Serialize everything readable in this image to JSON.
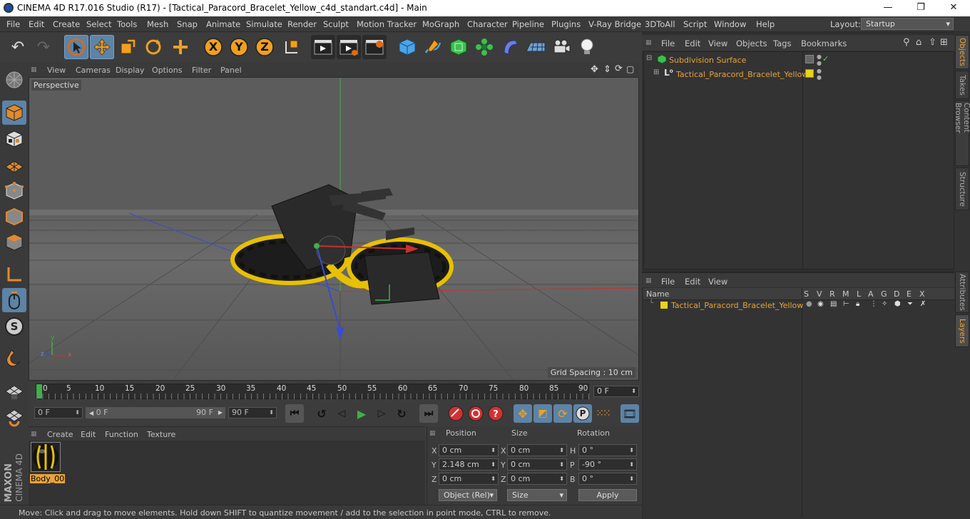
{
  "window": {
    "title": "CINEMA 4D R17.016 Studio (R17) - [Tactical_Paracord_Bracelet_Yellow_c4d_standart.c4d] - Main",
    "min": "—",
    "max": "❐",
    "close": "✕"
  },
  "menu": [
    "File",
    "Edit",
    "Create",
    "Select",
    "Tools",
    "Mesh",
    "Snap",
    "Animate",
    "Simulate",
    "Render",
    "Sculpt",
    "Motion Tracker",
    "MoGraph",
    "Character",
    "Pipeline",
    "Plugins",
    "V-Ray Bridge",
    "3DToAll",
    "Script",
    "Window",
    "Help"
  ],
  "layout": {
    "label": "Layout:",
    "value": "Startup"
  },
  "viewport": {
    "menu": [
      "View",
      "Cameras",
      "Display",
      "Options",
      "Filter",
      "Panel"
    ],
    "label": "Perspective",
    "grid_spacing": "Grid Spacing : 10 cm",
    "axis_labels": {
      "y": "y",
      "z": "z",
      "x": "x"
    }
  },
  "timeline": {
    "ticks": [
      "0",
      "5",
      "10",
      "15",
      "20",
      "25",
      "30",
      "35",
      "40",
      "45",
      "50",
      "55",
      "60",
      "65",
      "70",
      "75",
      "80",
      "85",
      "90"
    ],
    "current_frame": "0 F"
  },
  "playback": {
    "start": "0 F",
    "range_start": "0 F",
    "range_end": "90 F",
    "end": "90 F"
  },
  "material_manager": {
    "menu": [
      "Create",
      "Edit",
      "Function",
      "Texture"
    ],
    "material_name": "Body_00"
  },
  "coordinates": {
    "headers": {
      "position": "Position",
      "size": "Size",
      "rotation": "Rotation"
    },
    "rows": [
      {
        "axis": "X",
        "pos": "0 cm",
        "size_axis": "X",
        "size": "0 cm",
        "rot_axis": "H",
        "rot": "0 °"
      },
      {
        "axis": "Y",
        "pos": "2.148 cm",
        "size_axis": "Y",
        "size": "0 cm",
        "rot_axis": "P",
        "rot": "-90 °"
      },
      {
        "axis": "Z",
        "pos": "0 cm",
        "size_axis": "Z",
        "size": "0 cm",
        "rot_axis": "B",
        "rot": "0 °"
      }
    ],
    "mode": "Object (Rel)",
    "size_mode": "Size",
    "apply": "Apply"
  },
  "object_manager": {
    "menu": [
      "File",
      "Edit",
      "View",
      "Objects",
      "Tags",
      "Bookmarks"
    ],
    "objects": [
      {
        "name": "Subdivision Surface",
        "level": 0
      },
      {
        "name": "Tactical_Paracord_Bracelet_Yellow",
        "level": 1
      }
    ]
  },
  "layer_manager": {
    "menu": [
      "File",
      "Edit",
      "View"
    ],
    "column_name": "Name",
    "columns": [
      "S",
      "V",
      "R",
      "M",
      "L",
      "A",
      "G",
      "D",
      "E",
      "X"
    ],
    "layers": [
      {
        "name": "Tactical_Paracord_Bracelet_Yellow",
        "color": "#e8d418"
      }
    ]
  },
  "side_tabs": [
    "Objects",
    "Takes",
    "Content Browser",
    "Structure",
    "Attributes",
    "Layers"
  ],
  "status": "Move: Click and drag to move elements. Hold down SHIFT to quantize movement / add to the selection in point mode, CTRL to remove.",
  "brand": {
    "maxon": "MAXON",
    "cinema": "CINEMA 4D"
  },
  "colors": {
    "accent": "#e8a33a",
    "selected_tool": "#5d83a6",
    "layer_color": "#e8d418"
  }
}
